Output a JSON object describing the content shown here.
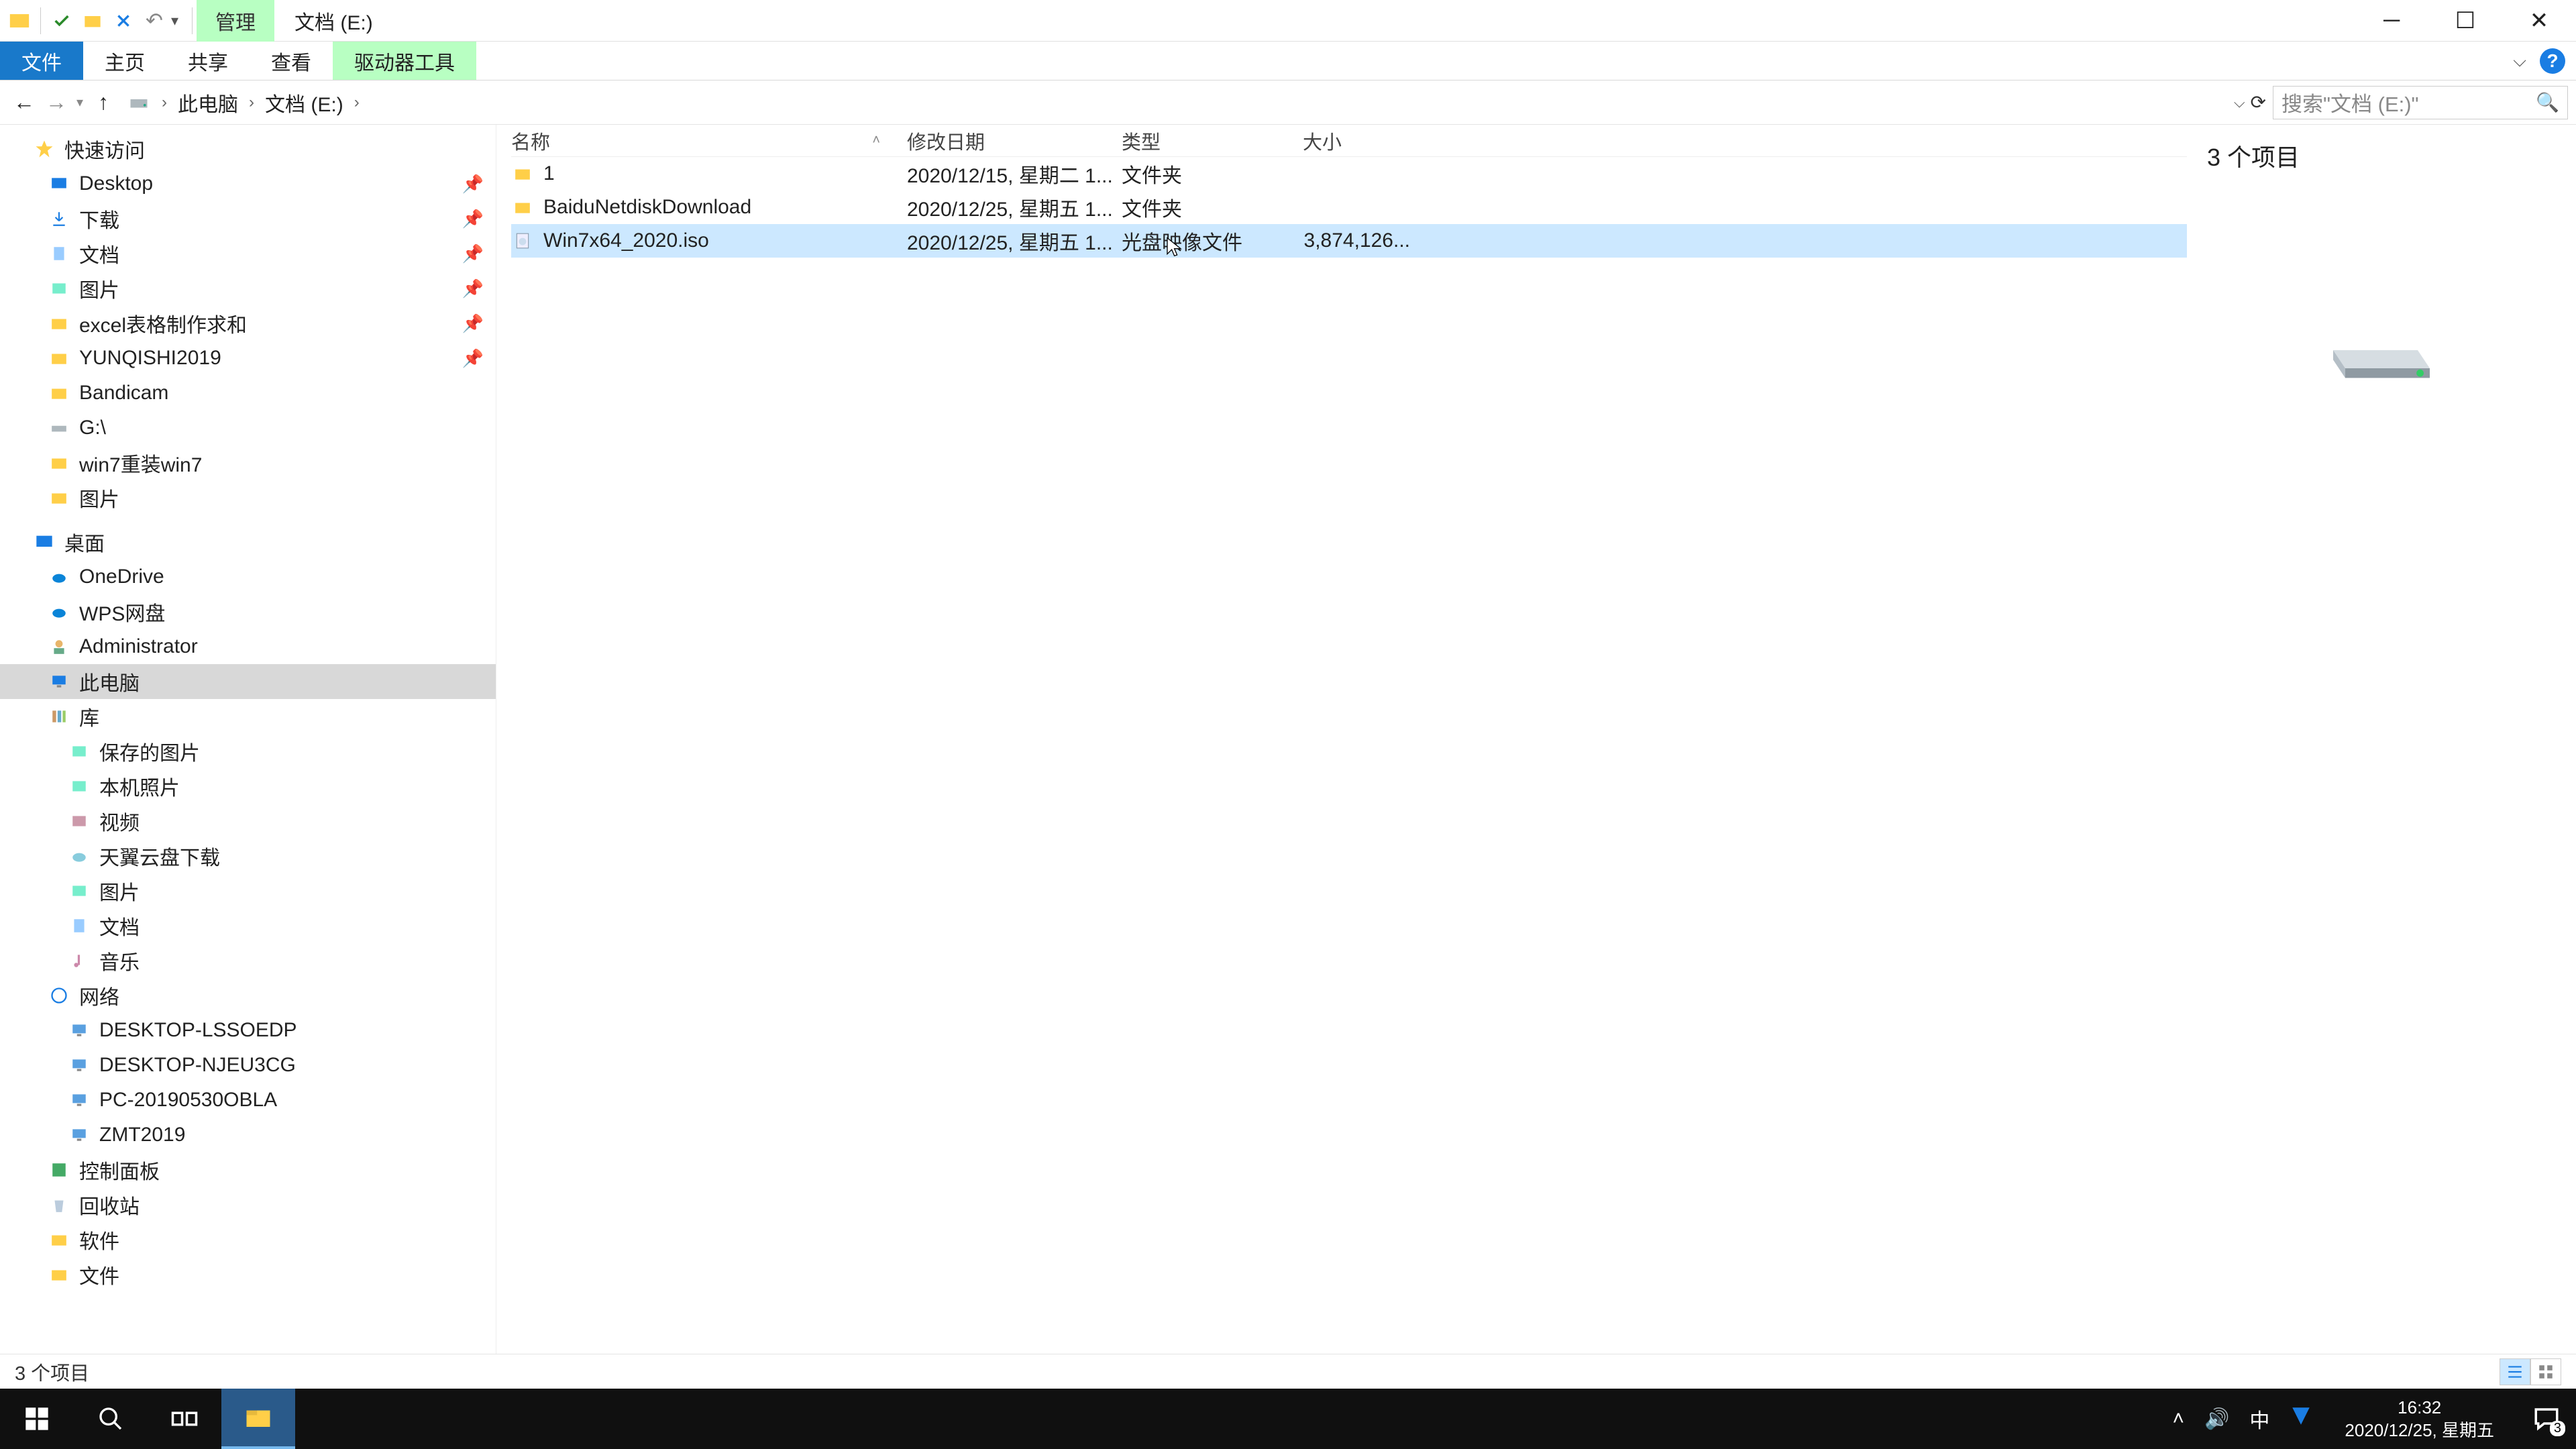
{
  "title": {
    "manage_tab": "管理",
    "window_title": "文档 (E:)"
  },
  "ribbon": {
    "file": "文件",
    "home": "主页",
    "share": "共享",
    "view": "查看",
    "drivetools": "驱动器工具"
  },
  "breadcrumb": {
    "pc": "此电脑",
    "drive": "文档 (E:)"
  },
  "search": {
    "placeholder": "搜索\"文档 (E:)\""
  },
  "columns": {
    "name": "名称",
    "date": "修改日期",
    "type": "类型",
    "size": "大小"
  },
  "files": [
    {
      "name": "1",
      "date": "2020/12/15, 星期二 1...",
      "type": "文件夹",
      "size": "",
      "icon": "folder"
    },
    {
      "name": "BaiduNetdiskDownload",
      "date": "2020/12/25, 星期五 1...",
      "type": "文件夹",
      "size": "",
      "icon": "folder"
    },
    {
      "name": "Win7x64_2020.iso",
      "date": "2020/12/25, 星期五 1...",
      "type": "光盘映像文件",
      "size": "3,874,126...",
      "icon": "iso",
      "selected": true
    }
  ],
  "nav": {
    "quick": "快速访问",
    "quick_items": [
      {
        "label": "Desktop",
        "icon": "desktop",
        "pinned": true
      },
      {
        "label": "下载",
        "icon": "download",
        "pinned": true
      },
      {
        "label": "文档",
        "icon": "doc",
        "pinned": true
      },
      {
        "label": "图片",
        "icon": "pic",
        "pinned": true
      },
      {
        "label": "excel表格制作求和",
        "icon": "folder",
        "pinned": true
      },
      {
        "label": "YUNQISHI2019",
        "icon": "folder",
        "pinned": true
      },
      {
        "label": "Bandicam",
        "icon": "folder"
      },
      {
        "label": "G:\\",
        "icon": "drive"
      },
      {
        "label": "win7重装win7",
        "icon": "folder"
      },
      {
        "label": "图片",
        "icon": "folder"
      }
    ],
    "desktop": "桌面",
    "desktop_items": [
      {
        "label": "OneDrive",
        "icon": "onedrive"
      },
      {
        "label": "WPS网盘",
        "icon": "wps"
      },
      {
        "label": "Administrator",
        "icon": "user"
      },
      {
        "label": "此电脑",
        "icon": "pc",
        "selected": true
      },
      {
        "label": "库",
        "icon": "library"
      }
    ],
    "library_items": [
      {
        "label": "保存的图片",
        "icon": "pic"
      },
      {
        "label": "本机照片",
        "icon": "pic"
      },
      {
        "label": "视频",
        "icon": "video"
      },
      {
        "label": "天翼云盘下载",
        "icon": "cloud"
      },
      {
        "label": "图片",
        "icon": "pic"
      },
      {
        "label": "文档",
        "icon": "doc"
      },
      {
        "label": "音乐",
        "icon": "music"
      }
    ],
    "network": "网络",
    "network_items": [
      {
        "label": "DESKTOP-LSSOEDP"
      },
      {
        "label": "DESKTOP-NJEU3CG"
      },
      {
        "label": "PC-20190530OBLA"
      },
      {
        "label": "ZMT2019"
      }
    ],
    "control_panel": "控制面板",
    "recycle": "回收站",
    "software": "软件",
    "documents": "文件"
  },
  "preview": {
    "count_text": "3 个项目"
  },
  "status": {
    "items": "3 个项目"
  },
  "clock": {
    "time": "16:32",
    "date": "2020/12/25, 星期五"
  },
  "tray": {
    "ime": "中",
    "notif_count": "3"
  }
}
